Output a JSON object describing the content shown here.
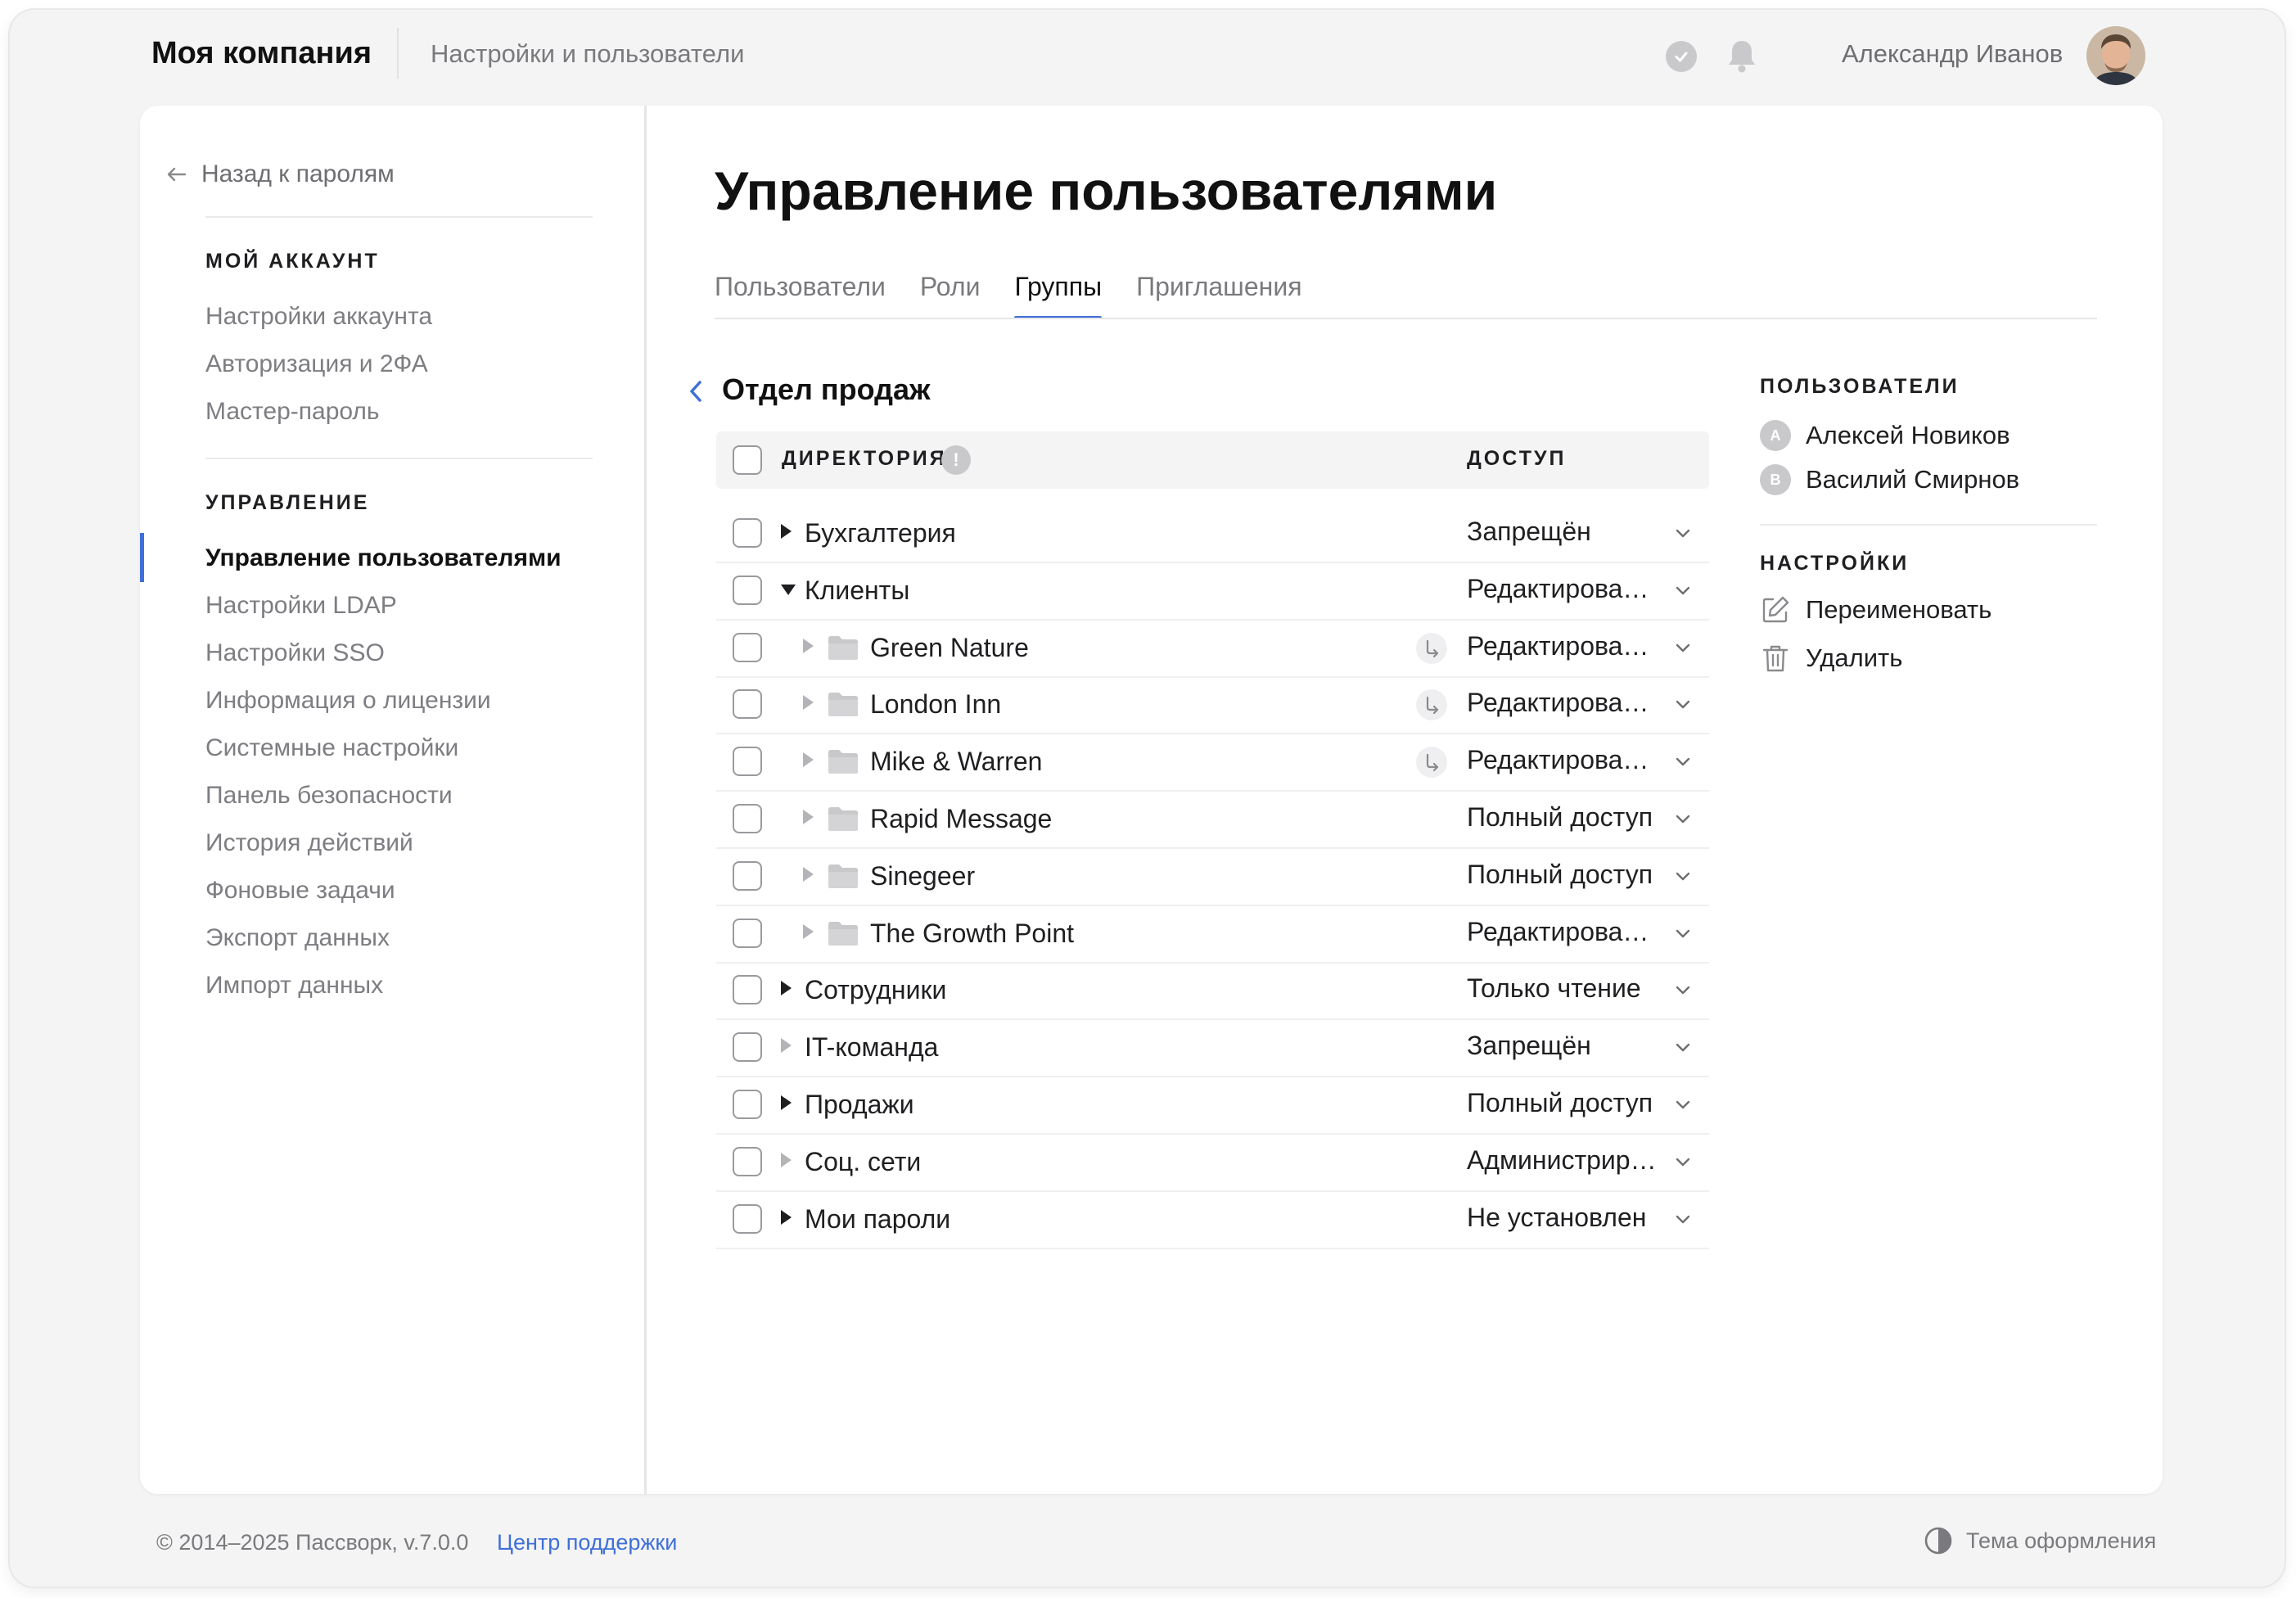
{
  "header": {
    "brand": "Моя компания",
    "section": "Настройки и пользователи",
    "user_name": "Александр Иванов"
  },
  "sidebar": {
    "back_label": "Назад к паролям",
    "account_heading": "МОЙ АККАУНТ",
    "account_items": [
      "Настройки аккаунта",
      "Авторизация и 2ФА",
      "Мастер-пароль"
    ],
    "manage_heading": "УПРАВЛЕНИЕ",
    "manage_items": [
      "Управление пользователями",
      "Настройки LDAP",
      "Настройки SSO",
      "Информация о лицензии",
      "Системные настройки",
      "Панель безопасности",
      "История действий",
      "Фоновые задачи",
      "Экспорт данных",
      "Импорт данных"
    ],
    "active_item": "Управление пользователями"
  },
  "main": {
    "title": "Управление пользователями",
    "tabs": [
      "Пользователи",
      "Роли",
      "Группы",
      "Приглашения"
    ],
    "active_tab": "Группы",
    "group_name": "Отдел продаж",
    "table": {
      "col_directory": "ДИРЕКТОРИЯ",
      "col_access": "ДОСТУП",
      "rows": [
        {
          "name": "Бухгалтерия",
          "access": "Запрещён"
        },
        {
          "name": "Клиенты",
          "access": "Редактирование"
        },
        {
          "name": "Green Nature",
          "access": "Редактирование"
        },
        {
          "name": "London Inn",
          "access": "Редактирование"
        },
        {
          "name": "Mike & Warren",
          "access": "Редактирование"
        },
        {
          "name": "Rapid Message",
          "access": "Полный доступ"
        },
        {
          "name": "Sinegeer",
          "access": "Полный доступ"
        },
        {
          "name": "The Growth Point",
          "access": "Редактирование"
        },
        {
          "name": "Сотрудники",
          "access": "Только чтение"
        },
        {
          "name": "IT-команда",
          "access": "Запрещён"
        },
        {
          "name": "Продажи",
          "access": "Полный доступ"
        },
        {
          "name": "Соц. сети",
          "access": "Администриро..."
        },
        {
          "name": "Мои пароли",
          "access": "Не установлен"
        }
      ]
    }
  },
  "right_panel": {
    "users_heading": "ПОЛЬЗОВАТЕЛИ",
    "users": [
      {
        "initial": "А",
        "name": "Алексей Новиков"
      },
      {
        "initial": "В",
        "name": "Василий Смирнов"
      }
    ],
    "settings_heading": "НАСТРОЙКИ",
    "rename_label": "Переименовать",
    "delete_label": "Удалить"
  },
  "footer": {
    "copyright": "© 2014–2025 Пассворк, v.7.0.0",
    "support_link": "Центр поддержки",
    "theme_label": "Тема оформления"
  },
  "colors": {
    "accent": "#3f6fd8",
    "muted_text": "#7a7a7e",
    "background": "#f4f4f5"
  }
}
